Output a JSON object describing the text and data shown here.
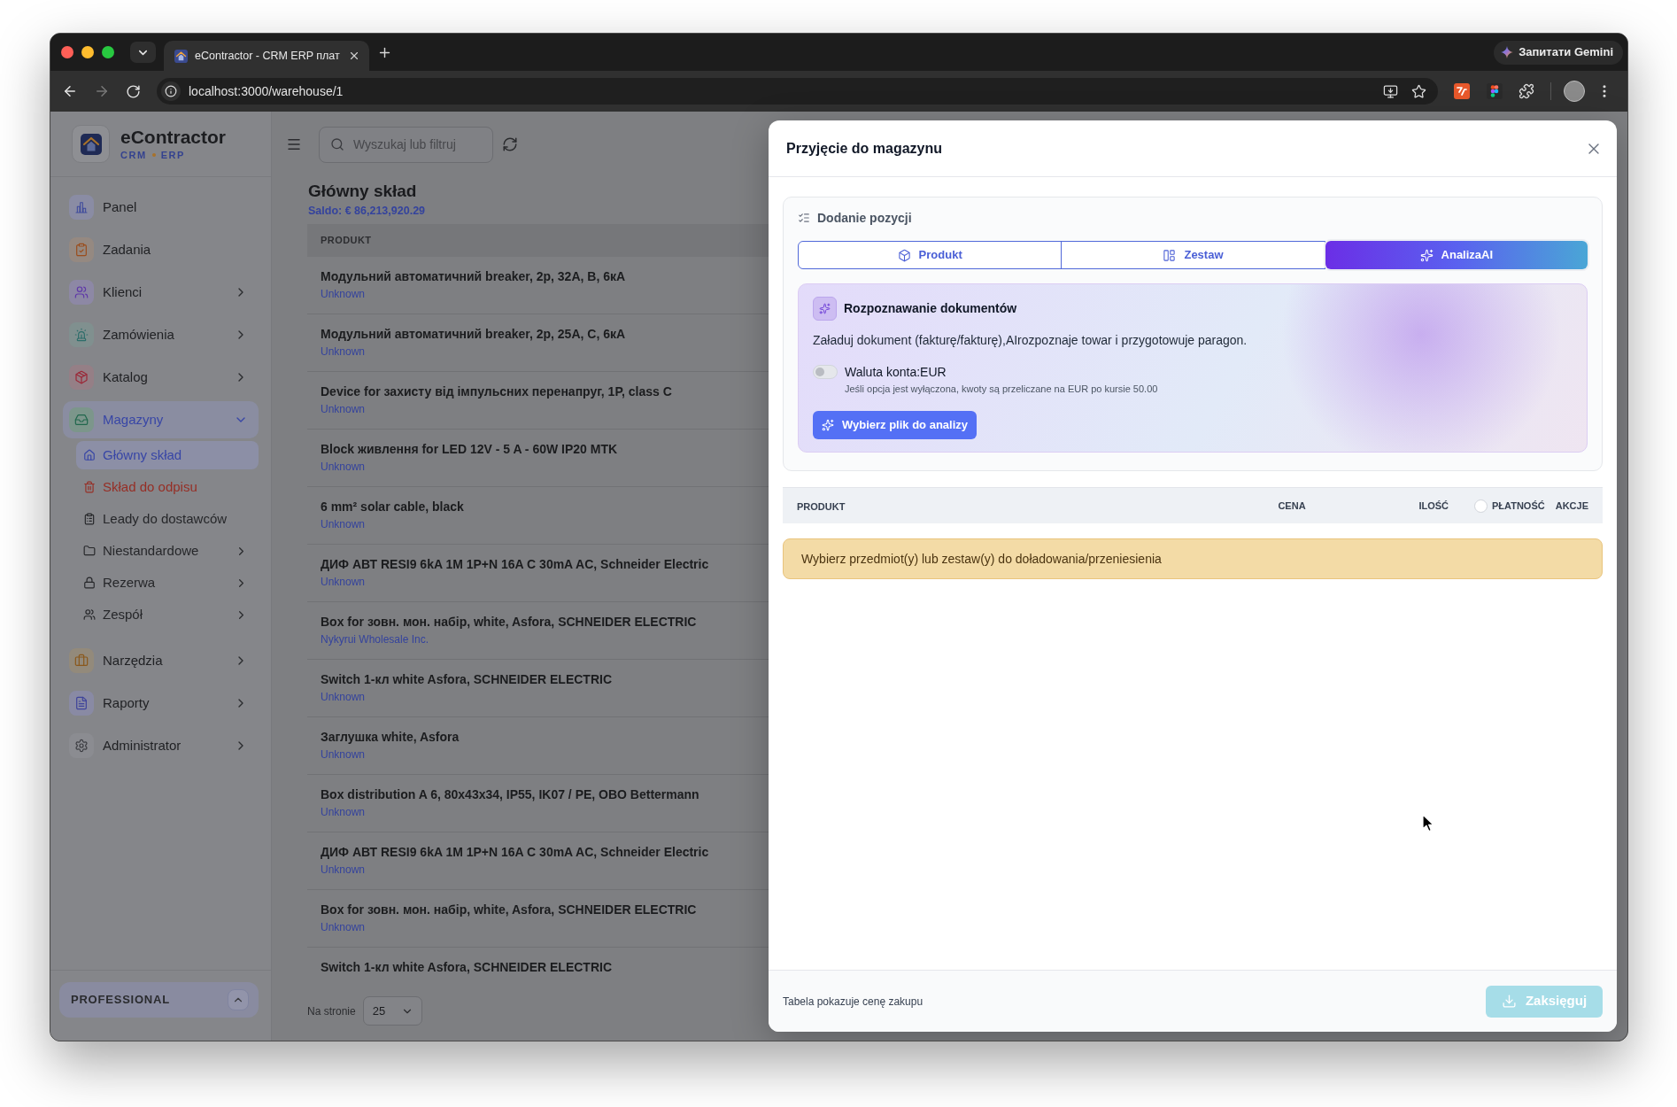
{
  "browser": {
    "tab_title": "eContractor - CRM ERP плат",
    "gemini_button": "Запитати Gemini",
    "url": "localhost:3000/warehouse/1"
  },
  "sidebar": {
    "brand": "eContractor",
    "tagline": [
      "CRM",
      "ERP"
    ],
    "items": [
      {
        "label": "Panel",
        "selected": false
      },
      {
        "label": "Zadania",
        "selected": false
      },
      {
        "label": "Klienci",
        "selected": false,
        "expanded": false
      },
      {
        "label": "Zamówienia",
        "selected": false,
        "expanded": false
      },
      {
        "label": "Katalog",
        "selected": false,
        "expanded": false
      },
      {
        "label": "Magazyny",
        "selected": true,
        "expanded": true,
        "children": [
          {
            "label": "Główny skład",
            "kind": "link",
            "selected": true
          },
          {
            "label": "Skład do odpisu",
            "kind": "danger",
            "selected": false
          },
          {
            "label": "Leady do dostawców",
            "kind": "link",
            "selected": false
          },
          {
            "label": "Niestandardowe",
            "kind": "link",
            "selected": false,
            "expanded": false
          },
          {
            "label": "Rezerwa",
            "kind": "link",
            "selected": false,
            "expanded": false
          },
          {
            "label": "Zespół",
            "kind": "link",
            "selected": false,
            "expanded": false
          }
        ]
      },
      {
        "label": "Narzędzia",
        "selected": false,
        "expanded": false
      },
      {
        "label": "Raporty",
        "selected": false,
        "expanded": false
      },
      {
        "label": "Administrator",
        "selected": false,
        "expanded": false
      }
    ],
    "plan": "PROFESSIONAL"
  },
  "topbar": {
    "search_placeholder": "Wyszukaj lub filtruj"
  },
  "warehouse": {
    "title": "Główny skład",
    "balance": "Saldo: € 86,213,920.29",
    "column": "PRODUKT",
    "rows": [
      {
        "name": "Модульний автоматичний breaker, 2p, 32A, B, 6кA",
        "subtitle": "Unknown"
      },
      {
        "name": "Модульний автоматичний breaker, 2p, 25A, C, 6кA",
        "subtitle": "Unknown"
      },
      {
        "name": "Device for захисту від імпульсних перенапруг, 1P, class C",
        "subtitle": "Unknown"
      },
      {
        "name": "Block живлення for LED 12V - 5 A - 60W IP20 MTK",
        "subtitle": "Unknown"
      },
      {
        "name": "6 mm² solar cable, black",
        "subtitle": "Unknown"
      },
      {
        "name": "ДИФ АВТ RESI9 6kA 1M 1P+N 16A C 30mA AC, Schneider Electric",
        "subtitle": "Unknown"
      },
      {
        "name": "Box for зовн. мон. набір, white, Asfora, SCHNEIDER ELECTRIC",
        "subtitle": "Nykyrui Wholesale Inc."
      },
      {
        "name": "Switch 1-кл white Asfora, SCHNEIDER ELECTRIC",
        "subtitle": "Unknown"
      },
      {
        "name": "Заглушка white, Asfora",
        "subtitle": "Unknown"
      },
      {
        "name": "Box distribution A 6, 80x43x34, IP55, IK07 / PE, OBO Bettermann",
        "subtitle": "Unknown"
      },
      {
        "name": "ДИФ АВТ RESI9 6kA 1M 1P+N 16A C 30mA AC, Schneider Electric",
        "subtitle": "Unknown"
      },
      {
        "name": "Box for зовн. мон. набір, white, Asfora, SCHNEIDER ELECTRIC",
        "subtitle": "Unknown"
      },
      {
        "name": "Switch 1-кл white Asfora, SCHNEIDER ELECTRIC"
      }
    ],
    "per_page_label": "Na stronie",
    "per_page": "25"
  },
  "modal": {
    "title": "Przyjęcie do magazynu",
    "section_title": "Dodanie pozycji",
    "tabs": [
      {
        "label": "Produkt",
        "selected": false
      },
      {
        "label": "Zestaw",
        "selected": false
      },
      {
        "label": "AnalizaAI",
        "selected": true
      }
    ],
    "ai_panel": {
      "title": "Rozpoznawanie dokumentów",
      "description": "Załaduj dokument (fakturę/fakturę),AIrozpoznaje towar i przygotowuje paragon.",
      "toggle": {
        "label": "Waluta konta:EUR",
        "on": false,
        "hint": "Jeśli opcja jest wyłączona, kwoty są przeliczane na EUR po kursie 50.00"
      },
      "button": "Wybierz plik do analizy"
    },
    "table": {
      "columns": [
        {
          "label": "PRODUKT",
          "kind": "text"
        },
        {
          "label": "CENA",
          "kind": "text"
        },
        {
          "label": "ILOŚĆ",
          "kind": "text"
        },
        {
          "label": "PŁATNOŚĆ",
          "kind": "checkbox",
          "checked": false
        },
        {
          "label": "AKCJE",
          "kind": "text"
        }
      ],
      "empty_message": "Wybierz przedmiot(y) lub zestaw(y) do doładowania/przeniesienia"
    },
    "footer_note": "Tabela pokazuje cenę zakupu",
    "submit": {
      "label": "Zaksięguj",
      "disabled": true
    }
  }
}
